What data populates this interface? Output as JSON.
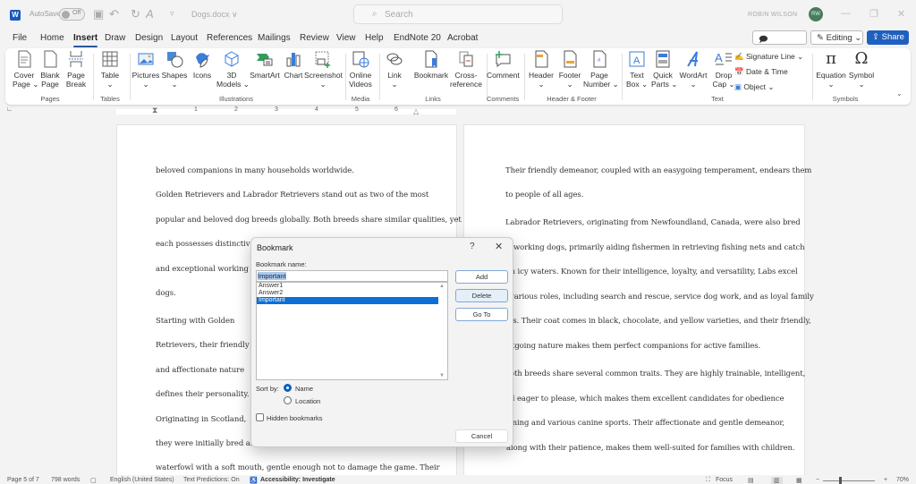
{
  "titlebar": {
    "logo": "W",
    "autosave_label": "AutoSave",
    "autosave_state": "Off",
    "document_name": "Dogs.docx ∨",
    "search_placeholder": "Search",
    "user_name": "ROBIN WILSON",
    "user_initials": "RW",
    "icons": {
      "save": "▣",
      "undo": "↶",
      "redo": "↻",
      "format": "A",
      "more": "▿",
      "minimize": "—",
      "restore": "❐",
      "close": "✕"
    }
  },
  "menu": {
    "tabs": [
      {
        "label": "File",
        "active": false
      },
      {
        "label": "Home",
        "active": false
      },
      {
        "label": "Insert",
        "active": true
      },
      {
        "label": "Draw",
        "active": false
      },
      {
        "label": "Design",
        "active": false
      },
      {
        "label": "Layout",
        "active": false
      },
      {
        "label": "References",
        "active": false
      },
      {
        "label": "Mailings",
        "active": false
      },
      {
        "label": "Review",
        "active": false
      },
      {
        "label": "View",
        "active": false
      },
      {
        "label": "Help",
        "active": false
      },
      {
        "label": "EndNote 20",
        "active": false
      },
      {
        "label": "Acrobat",
        "active": false
      }
    ],
    "comments_label": "Comments",
    "editing_label": "Editing ⌄",
    "share_label": "Share ⌄"
  },
  "ribbon": {
    "buttons": {
      "cover_page": "Cover\nPage ⌄",
      "blank_page": "Blank\nPage",
      "page_break": "Page\nBreak",
      "table": "Table\n⌄",
      "pictures": "Pictures\n⌄",
      "shapes": "Shapes\n⌄",
      "icons": "Icons",
      "models_3d": "3D\nModels ⌄",
      "smartart": "SmartArt",
      "chart": "Chart",
      "screenshot": "Screenshot\n⌄",
      "online_videos": "Online\nVideos",
      "link": "Link\n⌄",
      "bookmark": "Bookmark",
      "cross_reference": "Cross-\nreference",
      "comment": "Comment",
      "header": "Header\n⌄",
      "footer": "Footer\n⌄",
      "page_number": "Page\nNumber ⌄",
      "text_box": "Text\nBox ⌄",
      "quick_parts": "Quick\nParts ⌄",
      "wordart": "WordArt\n⌄",
      "drop_cap": "Drop\nCap ⌄",
      "signature_line": "Signature Line  ⌄",
      "date_time": "Date & Time",
      "object": "Object  ⌄",
      "equation": "Equation\n⌄",
      "symbol": "Symbol\n⌄"
    },
    "groups": [
      "Pages",
      "Tables",
      "Illustrations",
      "Media",
      "Links",
      "Comments",
      "Header & Footer",
      "Text",
      "Symbols"
    ]
  },
  "ruler": {
    "marks": [
      "1",
      "2",
      "3",
      "4",
      "5",
      "6"
    ]
  },
  "document": {
    "left_page_lines": [
      "beloved        companions        in        many        households        worldwide.",
      "Golden Retrievers and Labrador Retrievers stand out as two of the most",
      "popular and beloved dog breeds globally. Both breeds share similar qualities, yet",
      "each possesses distinctive ch",
      "and   exceptional   working",
      "dogs.",
      "Starting    with    Golden",
      "Retrievers,  their  friendly",
      "and   affectionate   nature",
      "defines  their  personality.",
      "Originating  in  Scotland,",
      "they  were  initially  bred  as",
      "waterfowl with a soft mouth, gentle enough not to damage the game. Their"
    ],
    "right_page_lines": [
      "Their friendly demeanor, coupled with an easygoing temperament, endears them",
      "to people of all ages.",
      "Labrador Retrievers, originating from Newfoundland, Canada, were also bred",
      "working dogs, primarily aiding fishermen in retrieving fishing nets and catch",
      "m icy waters. Known for their intelligence, loyalty, and versatility, Labs excel",
      "various roles, including search and rescue, service dog work, and as loyal family",
      "ts. Their coat comes in black, chocolate, and yellow varieties, and their friendly,",
      "tgoing nature makes them perfect companions for active families.",
      "oth breeds share several common traits. They are highly trainable, intelligent,",
      "d eager to please, which makes them excellent candidates for obedience",
      "ining and various canine sports. Their affectionate and gentle demeanor,",
      "along with their patience, makes them well-suited for families with children."
    ]
  },
  "dialog": {
    "title": "Bookmark",
    "help": "?",
    "close": "✕",
    "name_label": "Bookmark name:",
    "name_value": "Important",
    "bookmarks": [
      {
        "name": "Answer1",
        "selected": false
      },
      {
        "name": "Answer2",
        "selected": false
      },
      {
        "name": "Important",
        "selected": true
      }
    ],
    "add_label": "Add",
    "delete_label": "Delete",
    "goto_label": "Go To",
    "sort_by_label": "Sort by:",
    "sort_options": [
      {
        "label": "Name",
        "checked": true
      },
      {
        "label": "Location",
        "checked": false
      }
    ],
    "hidden_label": "Hidden bookmarks",
    "hidden_checked": false,
    "cancel_label": "Cancel"
  },
  "statusbar": {
    "page": "Page 5 of 7",
    "words": "798 words",
    "language": "English (United States)",
    "predictions": "Text Predictions: On",
    "accessibility": "Accessibility: Investigate",
    "focus": "Focus",
    "zoom_minus": "−",
    "zoom_plus": "+",
    "zoom_level": "70%",
    "zoom_percent": 70
  }
}
